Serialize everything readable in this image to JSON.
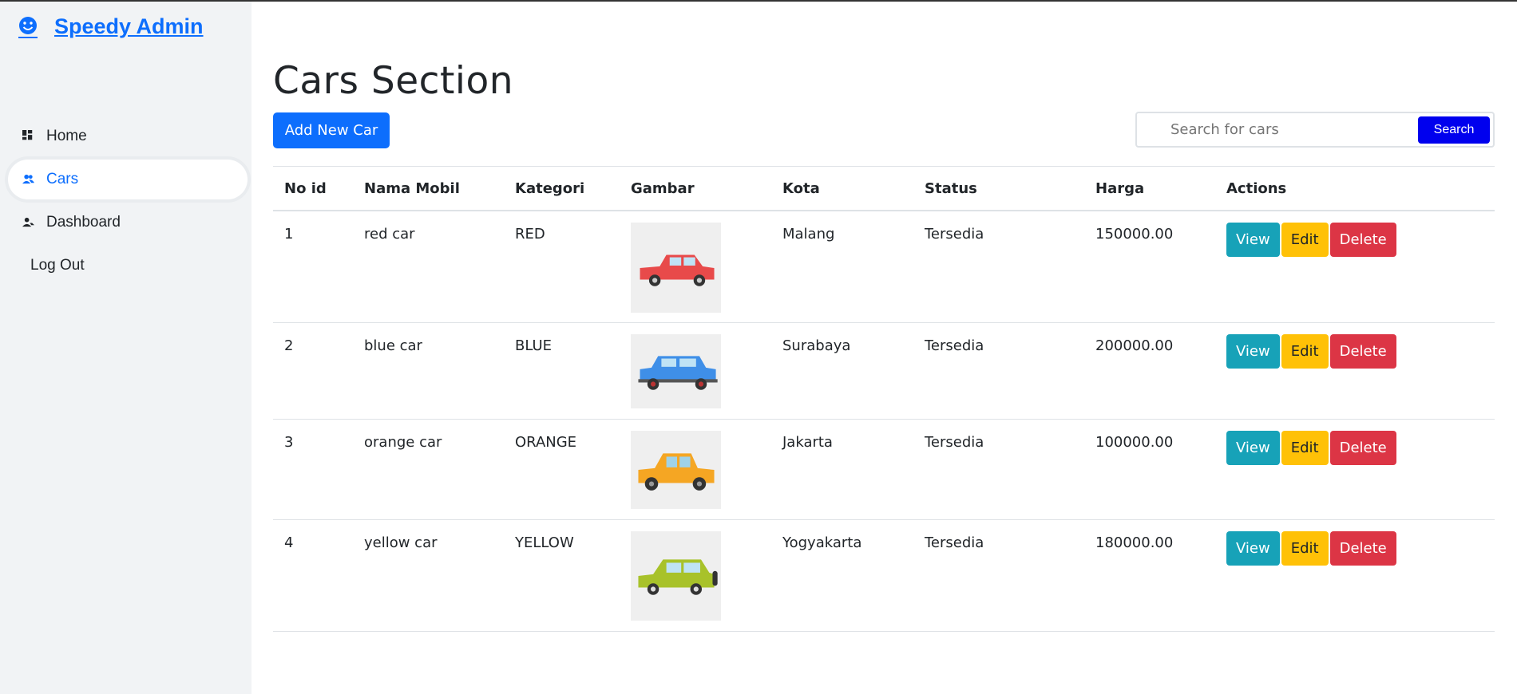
{
  "brand": {
    "name": "Speedy Admin",
    "icon": "smiley-icon",
    "color": "#0d6efd"
  },
  "sidebar": {
    "items": [
      {
        "label": "Home",
        "icon": "grid-icon"
      },
      {
        "label": "Cars",
        "icon": "users-icon",
        "active": true
      },
      {
        "label": "Dashboard",
        "icon": "user-icon"
      },
      {
        "label": "Log Out"
      }
    ]
  },
  "page": {
    "title": "Cars Section",
    "add_label": "Add New Car",
    "search_placeholder": "Search for cars",
    "search_label": "Search"
  },
  "table": {
    "columns": [
      "No id",
      "Nama Mobil",
      "Kategori",
      "Gambar",
      "Kota",
      "Status",
      "Harga",
      "Actions"
    ],
    "rows": [
      {
        "id": "1",
        "name": "red car",
        "category": "RED",
        "car_color": "#e84a4a",
        "city": "Malang",
        "status": "Tersedia",
        "price": "150000.00"
      },
      {
        "id": "2",
        "name": "blue car",
        "category": "BLUE",
        "car_color": "#3f8fe8",
        "city": "Surabaya",
        "status": "Tersedia",
        "price": "200000.00"
      },
      {
        "id": "3",
        "name": "orange car",
        "category": "ORANGE",
        "car_color": "#f5a623",
        "city": "Jakarta",
        "status": "Tersedia",
        "price": "100000.00"
      },
      {
        "id": "4",
        "name": "yellow car",
        "category": "YELLOW",
        "car_color": "#a8c22a",
        "city": "Yogyakarta",
        "status": "Tersedia",
        "price": "180000.00"
      }
    ],
    "actions": {
      "view": "View",
      "edit": "Edit",
      "delete": "Delete"
    }
  },
  "colors": {
    "view": "#17a2b8",
    "edit": "#ffc107",
    "delete": "#dc3545",
    "primary": "#0d6efd",
    "search_button": "#0000ee"
  }
}
